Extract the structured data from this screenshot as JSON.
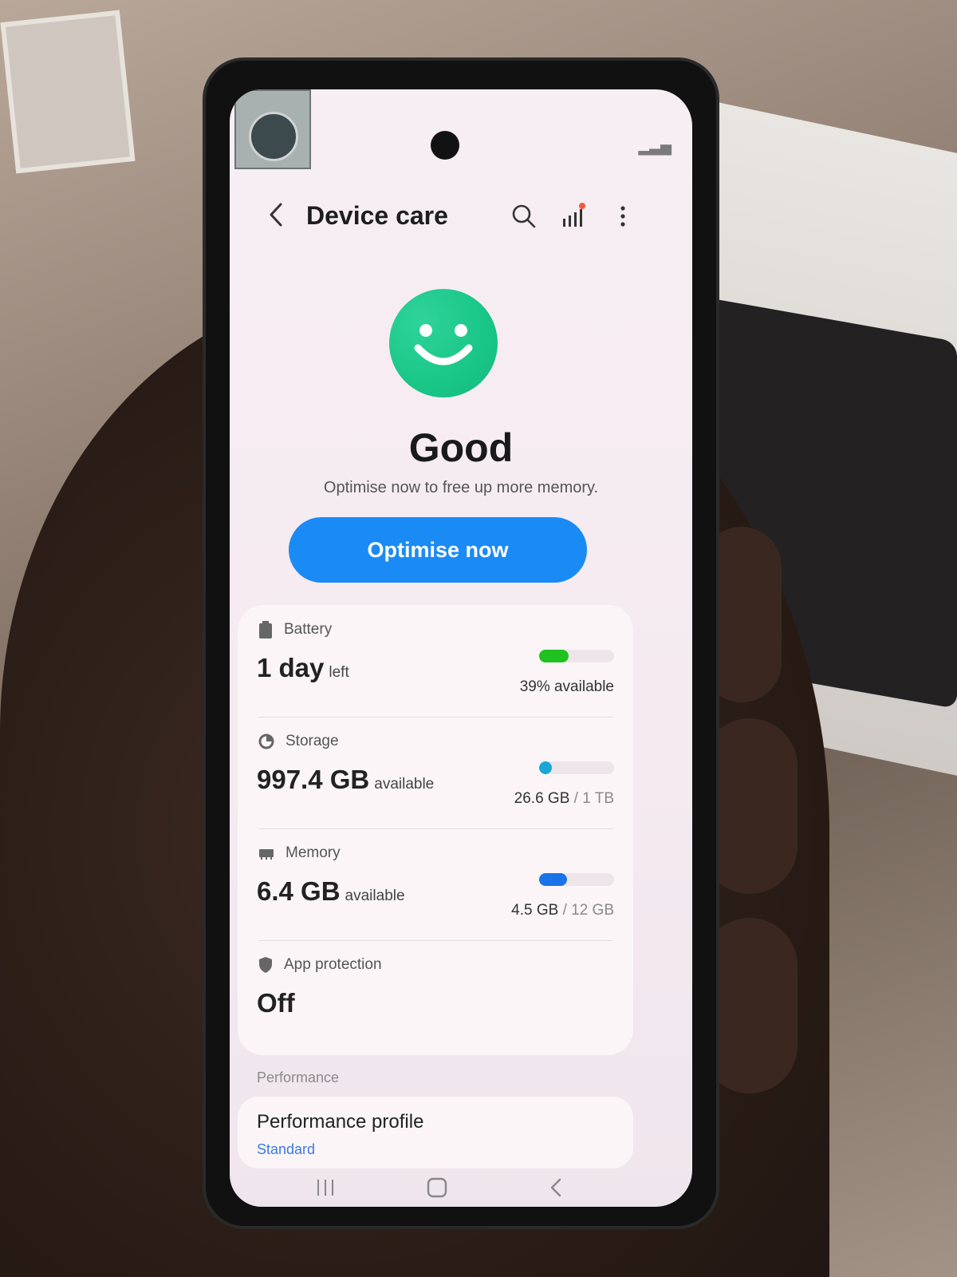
{
  "header": {
    "title": "Device care"
  },
  "status_summary": {
    "state": "Good",
    "message": "Optimise now to free up more memory.",
    "optimise_label": "Optimise now"
  },
  "items": {
    "battery": {
      "label": "Battery",
      "value": "1 day",
      "suffix": "left",
      "right": "39% available",
      "level": 0.39,
      "color": "#1fc21f"
    },
    "storage": {
      "label": "Storage",
      "value": "997.4 GB",
      "suffix": "available",
      "used": "26.6 GB",
      "total": "/ 1 TB",
      "color": "#1aa7d8"
    },
    "memory": {
      "label": "Memory",
      "value": "6.4 GB",
      "suffix": "available",
      "used": "4.5 GB",
      "total": "/ 12 GB",
      "color": "#1a73e8"
    },
    "app_protection": {
      "label": "App protection",
      "value": "Off"
    }
  },
  "performance": {
    "section_label": "Performance",
    "profile_title": "Performance profile",
    "profile_value": "Standard"
  },
  "colors": {
    "accent": "#1a8bf5",
    "good_green": "#19c687"
  },
  "icons": [
    "back-arrow-icon",
    "search-icon",
    "stats-icon",
    "more-options-icon",
    "smiley-icon",
    "battery-icon",
    "storage-icon",
    "memory-icon",
    "shield-icon",
    "recents-icon",
    "home-icon",
    "back-nav-icon"
  ]
}
